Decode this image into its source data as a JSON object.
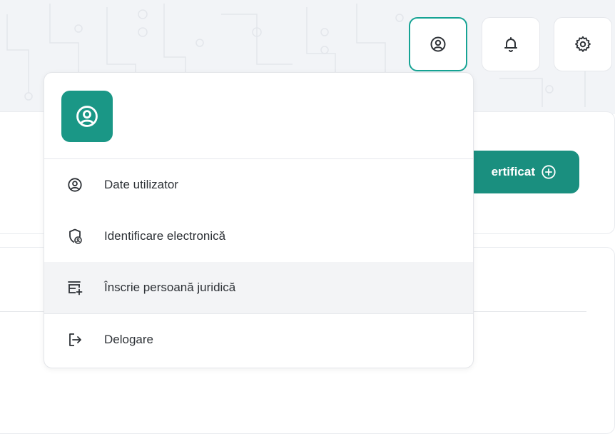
{
  "header": {
    "profile_button": {
      "icon": "user-circle-icon"
    },
    "notifications_button": {
      "icon": "bell-icon"
    },
    "settings_button": {
      "icon": "gear-icon"
    }
  },
  "background": {
    "certificate_button_label": "ertificat"
  },
  "user_menu": {
    "avatar_icon": "user-circle-icon",
    "items": [
      {
        "label": "Date utilizator",
        "icon": "user-circle-icon"
      },
      {
        "label": "Identificare electronică",
        "icon": "shield-user-icon"
      },
      {
        "label": "Înscrie persoană juridică",
        "icon": "store-add-icon"
      },
      {
        "label": "Delogare",
        "icon": "logout-icon"
      }
    ]
  },
  "colors": {
    "accent": "#1a9786",
    "active_border": "#16a394",
    "highlight_row": "#f3f4f6"
  }
}
